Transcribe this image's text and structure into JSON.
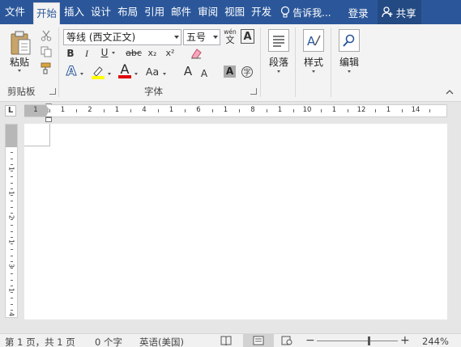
{
  "tabs": [
    {
      "label": "文件"
    },
    {
      "label": "开始"
    },
    {
      "label": "插入"
    },
    {
      "label": "设计"
    },
    {
      "label": "布局"
    },
    {
      "label": "引用"
    },
    {
      "label": "邮件"
    },
    {
      "label": "审阅"
    },
    {
      "label": "视图"
    },
    {
      "label": "开发"
    }
  ],
  "header": {
    "tell_me": "告诉我...",
    "login": "登录",
    "share": "共享"
  },
  "ribbon": {
    "clipboard": {
      "paste_label": "粘贴",
      "group_label": "剪贴板"
    },
    "font": {
      "font_name": "等线 (西文正文)",
      "font_size": "五号",
      "wen_top": "wén",
      "wen_bottom": "文",
      "border_char": "A",
      "bold": "B",
      "italic": "I",
      "underline": "U",
      "strike": "abc",
      "subscript": "x₂",
      "superscript": "x²",
      "text_effect": "A",
      "font_color": "A",
      "case": "Aa",
      "grow": "A",
      "shrink": "A",
      "shade": "A",
      "group_label": "字体"
    },
    "paragraph": {
      "label": "段落"
    },
    "styles": {
      "label": "样式"
    },
    "editing": {
      "label": "编辑"
    }
  },
  "ruler": {
    "corner": "L",
    "h_labels": [
      "1",
      "1",
      "2",
      "1",
      "4",
      "1",
      "6",
      "1",
      "8",
      "1",
      "10",
      "1",
      "12",
      "1",
      "14"
    ],
    "v_labels": [
      "1",
      "1",
      "2",
      "1",
      "3",
      "1",
      "4"
    ]
  },
  "status": {
    "page": "第 1 页，共 1 页",
    "words": "0 个字",
    "language": "英语(美国)",
    "zoom": "244%"
  },
  "colors": {
    "brand": "#2b579a",
    "highlight": "#ffff00",
    "font_color": "#e00000"
  }
}
